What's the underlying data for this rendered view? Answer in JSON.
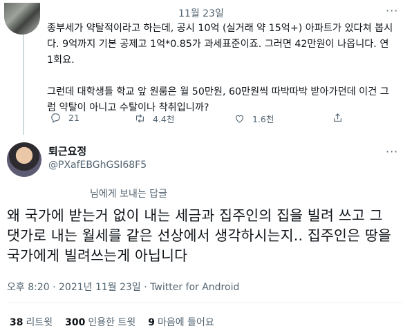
{
  "quoted_tweet": {
    "date": "11월 23일",
    "text": "종부세가 약탈적이라고 하는데, 공시 10억 (실거래 약 15억+) 아파트가 있다쳐 봅시다. 9억까지 기본 공제고 1억*0.85가 과세표준이죠. 그러면 42만원이 나옵니다. 연 1회요.\n\n그런데 대학생들 학교 앞 원룸은 월 50만원, 60만원씩 따박따박 받아가던데 이건 그럼 약탈이 아니고 수탈이나 착취입니까?",
    "actions": {
      "reply_count": "21",
      "retweet_count": "4.4천",
      "like_count": "1.6천"
    }
  },
  "author": {
    "name": "퇴근요정",
    "handle": "@PXafEBGhGSI68F5"
  },
  "reply_label": "님에게 보내는 답글",
  "tweet": {
    "text": "왜 국가에 받는거 없이 내는 세금과 집주인의 집을 빌려 쓰고 그 댓가로 내는 월세를 같은 선상에서 생각하시는지.. 집주인은 땅을 국가에게 빌려쓰는게 아닙니다",
    "meta": "오후 8:20 · 2021년 11월 23일 · Twitter for Android"
  },
  "stats": {
    "retweets": {
      "count": "38",
      "label": "리트윗"
    },
    "quote_tweets": {
      "count": "300",
      "label": "인용한 트윗"
    },
    "likes": {
      "count": "9",
      "label": "마음에 들어요"
    }
  },
  "icons": [
    "reply-icon",
    "retweet-icon",
    "like-icon",
    "share-icon",
    "more-icon"
  ],
  "colors": {
    "secondary_text": "#536471",
    "primary_text": "#0f1419",
    "line": "#cfd9de"
  }
}
